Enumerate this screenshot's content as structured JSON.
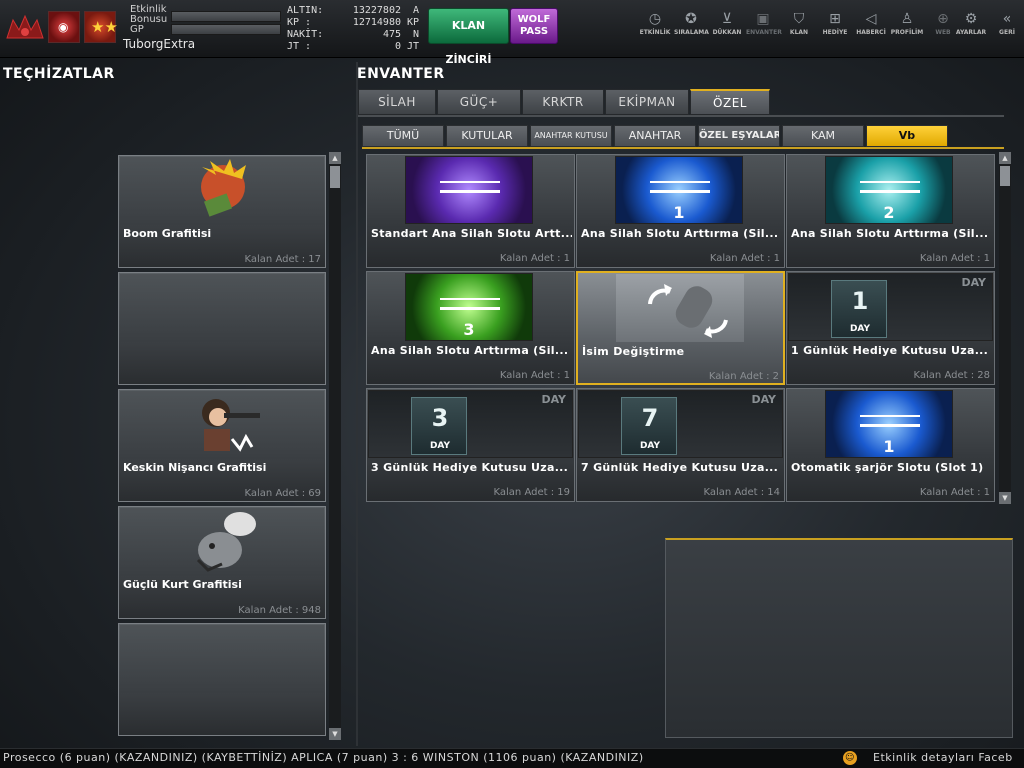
{
  "topbar": {
    "etkinlik_bonusu_label": "Etkinlik Bonusu",
    "gp_label": "GP",
    "username": "TuborgExtra",
    "currencies": [
      {
        "label": "ALTIN:",
        "value": "13227802",
        "unit": "A"
      },
      {
        "label": "KP   :",
        "value": "12714980",
        "unit": "KP"
      },
      {
        "label": "NAKİT:",
        "value": "475",
        "unit": "N"
      },
      {
        "label": "JT   :",
        "value": "0",
        "unit": "JT"
      }
    ],
    "klan_zinciri": "KLAN ZİNCİRİ",
    "wolf_pass_line1": "WOLF",
    "wolf_pass_line2": "PASS"
  },
  "nav": [
    {
      "label": "ETKİNLİK",
      "icon": "clock-icon"
    },
    {
      "label": "SIRALAMA",
      "icon": "medal-icon"
    },
    {
      "label": "DÜKKAN",
      "icon": "cart-icon"
    },
    {
      "label": "ENVANTER",
      "icon": "inventory-icon"
    },
    {
      "label": "KLAN",
      "icon": "shield-icon"
    },
    {
      "label": "HEDİYE",
      "icon": "gift-icon"
    },
    {
      "label": "HABERCİ",
      "icon": "megaphone-icon"
    },
    {
      "label": "PROFİLİM",
      "icon": "profile-icon"
    },
    {
      "label": "WEB",
      "icon": "globe-icon"
    },
    {
      "label": "AYARLAR",
      "icon": "gear-icon"
    },
    {
      "label": "GERİ",
      "icon": "back-icon"
    }
  ],
  "left": {
    "title": "TEÇHİZATLAR",
    "items": [
      {
        "name": "Boom Grafitisi",
        "count": "Kalan Adet : 17"
      },
      {
        "name": "",
        "count": ""
      },
      {
        "name": "Keskin Nişancı Grafitisi",
        "count": "Kalan Adet : 69"
      },
      {
        "name": "Güçlü Kurt Grafitisi",
        "count": "Kalan Adet : 948"
      },
      {
        "name": "",
        "count": ""
      }
    ]
  },
  "main": {
    "title": "ENVANTER",
    "tabs": [
      "SİLAH",
      "GÜÇ+",
      "KRKTR",
      "EKİPMAN",
      "ÖZEL"
    ],
    "subtabs": [
      "TÜMÜ",
      "KUTULAR",
      "ANAHTAR KUTUSU",
      "ANAHTAR",
      "ÖZEL EŞYALAR",
      "KAM",
      "Vb"
    ],
    "items": [
      {
        "name": "Standart Ana Silah Slotu Artt...",
        "count": "Kalan Adet : 1",
        "num": ""
      },
      {
        "name": "Ana Silah Slotu Arttırma (Sil...",
        "count": "Kalan Adet : 1",
        "num": "1"
      },
      {
        "name": "Ana Silah Slotu Arttırma (Sil...",
        "count": "Kalan Adet : 1",
        "num": "2"
      },
      {
        "name": "Ana Silah Slotu Arttırma (Sil...",
        "count": "Kalan Adet : 1",
        "num": "3"
      },
      {
        "name": "İsim Değiştirme",
        "count": "Kalan Adet : 2",
        "num": ""
      },
      {
        "name": "1 Günlük Hediye Kutusu Uza...",
        "count": "Kalan Adet : 28",
        "num": "1",
        "day": "DAY"
      },
      {
        "name": "3 Günlük Hediye Kutusu Uza...",
        "count": "Kalan Adet : 19",
        "num": "3",
        "day": "DAY"
      },
      {
        "name": "7 Günlük Hediye Kutusu Uza...",
        "count": "Kalan Adet : 14",
        "num": "7",
        "day": "DAY"
      },
      {
        "name": "Otomatik şarjör Slotu (Slot 1)",
        "count": "Kalan Adet : 1",
        "num": "1"
      }
    ]
  },
  "ticker": {
    "text": "Prosecco (6 puan) (KAZANDINIZ)        (KAYBETTİNİZ) APLICA (7 puan) 3 : 6 WINSTON (1106 puan) (KAZANDINIZ)",
    "right_text": "Etkinlik detayları Faceb"
  },
  "colors": {
    "accent": "#e0b020",
    "klan": "#1a8a50",
    "wolf": "#9a3ab8"
  }
}
